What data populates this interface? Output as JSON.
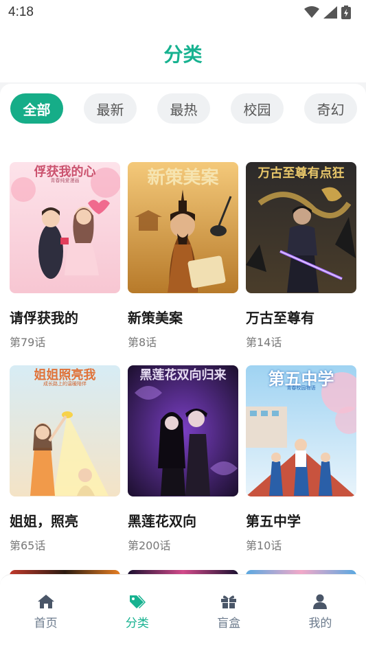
{
  "status": {
    "time": "4:18"
  },
  "header": {
    "title": "分类"
  },
  "categories": [
    {
      "label": "全部",
      "active": true
    },
    {
      "label": "最新",
      "active": false
    },
    {
      "label": "最热",
      "active": false
    },
    {
      "label": "校园",
      "active": false
    },
    {
      "label": "奇幻",
      "active": false
    }
  ],
  "books": [
    {
      "title": "请俘获我的",
      "episodes": "第79话",
      "cover_title": "俘获我的心",
      "cover_sub": "青春纯爱漫画"
    },
    {
      "title": "新策美案",
      "episodes": "第8话",
      "cover_title": "新策美案"
    },
    {
      "title": "万古至尊有",
      "episodes": "第14话",
      "cover_title": "万古至尊有点狂"
    },
    {
      "title": "姐姐，照亮",
      "episodes": "第65话",
      "cover_title": "姐姐照亮我",
      "cover_sub": "成长路上的温暖陪伴"
    },
    {
      "title": "黑莲花双向",
      "episodes": "第200话",
      "cover_title": "黑莲花双向归来"
    },
    {
      "title": "第五中学",
      "episodes": "第10话",
      "cover_title": "第五中学",
      "cover_sub": "青春校园物语"
    }
  ],
  "nav": [
    {
      "label": "首页",
      "icon": "home-icon",
      "active": false
    },
    {
      "label": "分类",
      "icon": "tag-icon",
      "active": true
    },
    {
      "label": "盲盒",
      "icon": "gift-icon",
      "active": false
    },
    {
      "label": "我的",
      "icon": "user-icon",
      "active": false
    }
  ],
  "colors": {
    "accent": "#17b290",
    "chip_active": "#16ad88"
  }
}
